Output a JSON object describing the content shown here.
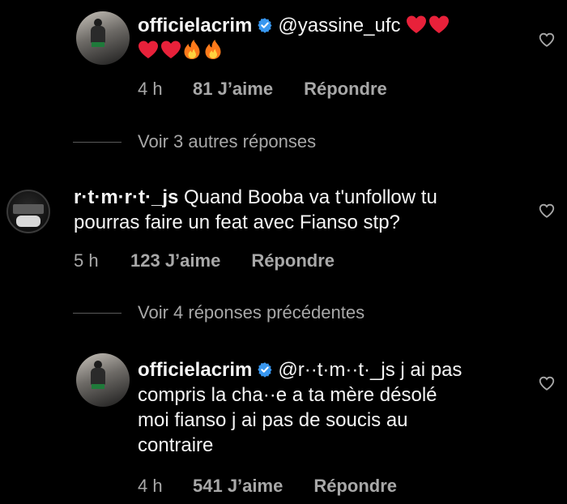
{
  "comments": [
    {
      "id": "c1",
      "username": "officielacrim",
      "verified": true,
      "mention": "@yassine_ufc",
      "text": "",
      "emojis": [
        "heart",
        "heart",
        "heart",
        "heart",
        "fire",
        "fire"
      ],
      "time": "4 h",
      "likes": "81 J’aime",
      "reply_label": "Répondre"
    },
    {
      "id": "c2",
      "username": "r·t·m·r·t·_js",
      "verified": false,
      "mention": "",
      "text_line1": "Quand Booba va t'unfollow tu",
      "text_line2": "pourras faire un feat avec Fianso stp?",
      "time": "5 h",
      "likes": "123 J’aime",
      "reply_label": "Répondre"
    },
    {
      "id": "c3",
      "username": "officielacrim",
      "verified": true,
      "mention": "@r··t·m··t·_js",
      "text_line1": "j ai pas",
      "text_line2": "compris la cha··e a ta mère désolé",
      "text_line3": "moi fianso j ai pas de soucis au",
      "text_line4": "contraire",
      "time": "4 h",
      "likes": "541 J’aime",
      "reply_label": "Répondre"
    }
  ],
  "view_more": [
    {
      "label": "Voir 3 autres réponses"
    },
    {
      "label": "Voir 4 réponses précédentes"
    }
  ],
  "colors": {
    "background": "#000000",
    "text": "#f5f5f5",
    "muted": "#a8a8a8",
    "verified": "#3897f0",
    "heart_emoji": "#e8213a",
    "fire_emoji": "#ff7a1a"
  },
  "icons": {
    "like": "heart-outline-icon",
    "verified": "verified-badge-icon"
  }
}
